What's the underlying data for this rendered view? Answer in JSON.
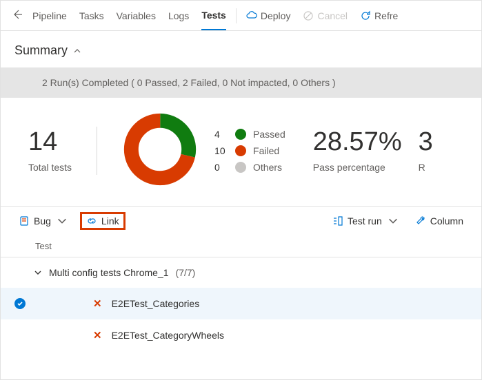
{
  "nav": {
    "tabs": [
      "Pipeline",
      "Tasks",
      "Variables",
      "Logs",
      "Tests"
    ],
    "active": 4,
    "deploy": "Deploy",
    "cancel": "Cancel",
    "refresh": "Refre"
  },
  "summary": {
    "title": "Summary",
    "status": "2 Run(s) Completed ( 0 Passed, 2 Failed, 0 Not impacted, 0 Others )"
  },
  "metrics": {
    "total": "14",
    "total_label": "Total tests",
    "pass_pct": "28.57%",
    "pass_label": "Pass percentage",
    "extra_num": "3",
    "extra_label": "R"
  },
  "legend": {
    "passed": {
      "count": "4",
      "label": "Passed",
      "color": "#107c10"
    },
    "failed": {
      "count": "10",
      "label": "Failed",
      "color": "#d83b01"
    },
    "others": {
      "count": "0",
      "label": "Others",
      "color": "#c8c6c4"
    }
  },
  "toolbar": {
    "bug": "Bug",
    "link": "Link",
    "testrun": "Test run",
    "column": "Column"
  },
  "table": {
    "header": "Test",
    "group": {
      "name": "Multi config tests Chrome_1",
      "count": "(7/7)"
    },
    "rows": [
      {
        "name": "E2ETest_Categories",
        "selected": true
      },
      {
        "name": "E2ETest_CategoryWheels",
        "selected": false
      }
    ]
  },
  "chart_data": {
    "type": "pie",
    "title": "",
    "series": [
      {
        "name": "Passed",
        "value": 4,
        "color": "#107c10"
      },
      {
        "name": "Failed",
        "value": 10,
        "color": "#d83b01"
      },
      {
        "name": "Others",
        "value": 0,
        "color": "#c8c6c4"
      }
    ],
    "total": 14,
    "donut": true
  }
}
